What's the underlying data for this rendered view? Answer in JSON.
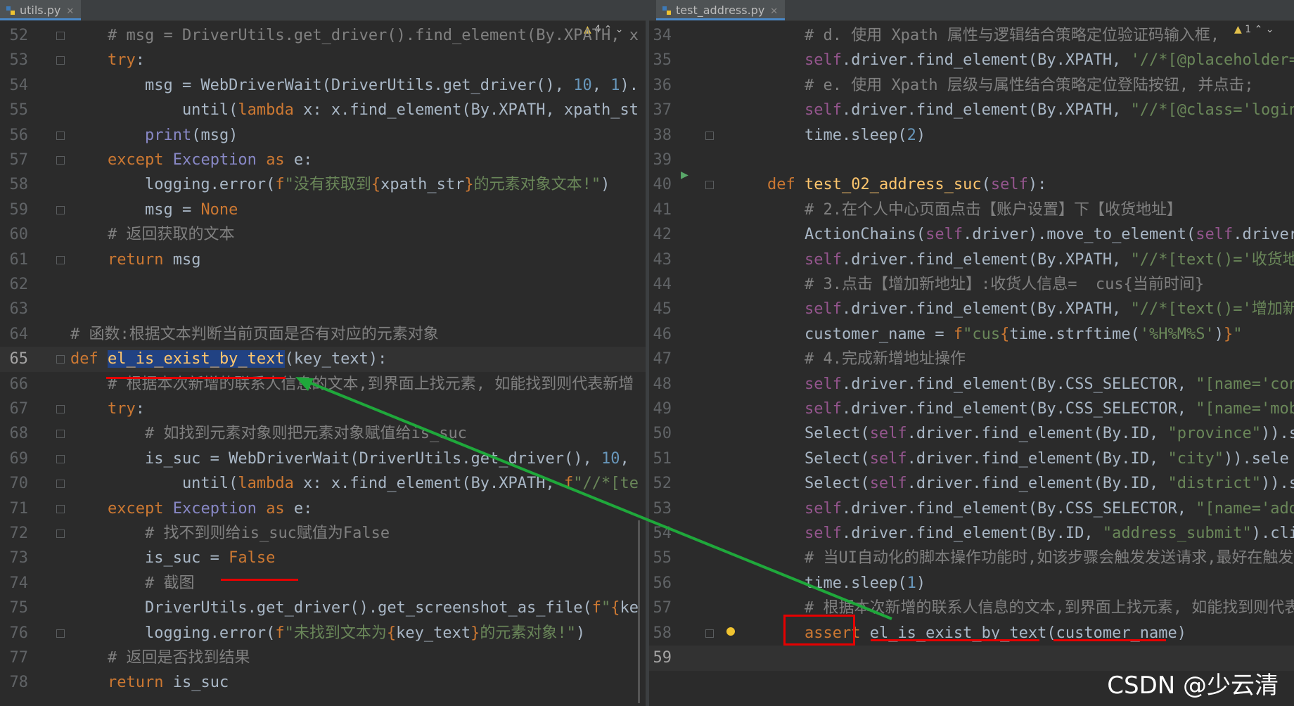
{
  "left_tab": {
    "name": "utils.py"
  },
  "right_tab": {
    "name": "test_address.py"
  },
  "left_warnings": "4",
  "right_warnings": "1",
  "watermark": "CSDN @少云清",
  "colors": {
    "keyword": "#cc7832",
    "comment": "#808080",
    "string": "#6a8759",
    "number": "#6897bb",
    "self": "#94558d",
    "function": "#ffc66d",
    "annotation_red": "#e60000",
    "arrow_green": "#1fa83b"
  },
  "left_lines": [
    {
      "n": "52",
      "html": "    <span class=\"cm\"># msg = DriverUtils.get_driver().find_element(By.XPATH, x</span>"
    },
    {
      "n": "53",
      "html": "    <span class=\"kw\">try</span>:"
    },
    {
      "n": "54",
      "html": "        msg = WebDriverWait(DriverUtils.get_driver(), <span class=\"num\">10</span>, <span class=\"num\">1</span>)."
    },
    {
      "n": "55",
      "html": "            until(<span class=\"kw\">lambda</span> x: x.find_element(By.XPATH, xpath_st"
    },
    {
      "n": "56",
      "html": "        <span class=\"bi\">print</span>(msg)"
    },
    {
      "n": "57",
      "html": "    <span class=\"kw\">except</span> <span class=\"bi\">Exception</span> <span class=\"kw\">as</span> e:"
    },
    {
      "n": "58",
      "html": "        logging.error(<span class=\"kw\">f</span><span class=\"str\">\"没有获取到</span><span class=\"kw\">{</span>xpath_str<span class=\"kw\">}</span><span class=\"str\">的元素对象文本!\"</span>)"
    },
    {
      "n": "59",
      "html": "        msg = <span class=\"kw\">None</span>"
    },
    {
      "n": "60",
      "html": "    <span class=\"cm\"># 返回获取的文本</span>"
    },
    {
      "n": "61",
      "html": "    <span class=\"kw\">return</span> msg"
    },
    {
      "n": "62",
      "html": ""
    },
    {
      "n": "63",
      "html": ""
    },
    {
      "n": "64",
      "html": "<span class=\"cm\"># 函数:根据文本判断当前页面是否有对应的元素对象</span>"
    },
    {
      "n": "65",
      "html": "<span class=\"kw\">def</span> <span class=\"fn sel\">el_is_exist_by_text</span>(key_text):",
      "cur": true
    },
    {
      "n": "66",
      "html": "    <span class=\"cm\"># 根据本次新增的联系人信息的文本,到界面上找元素, 如能找到则代表新增</span>"
    },
    {
      "n": "67",
      "html": "    <span class=\"kw\">try</span>:"
    },
    {
      "n": "68",
      "html": "        <span class=\"cm\"># 如找到元素对象则把元素对象赋值给is_suc</span>"
    },
    {
      "n": "69",
      "html": "        is_suc = WebDriverWait(DriverUtils.get_driver(), <span class=\"num\">10</span>,"
    },
    {
      "n": "70",
      "html": "            until(<span class=\"kw\">lambda</span> x: x.find_element(By.XPATH, <span class=\"kw\">f</span><span class=\"str\">\"//*[te</span>"
    },
    {
      "n": "71",
      "html": "    <span class=\"kw\">except</span> <span class=\"bi\">Exception</span> <span class=\"kw\">as</span> e:"
    },
    {
      "n": "72",
      "html": "        <span class=\"cm\"># 找不到则给is_suc赋值为False</span>"
    },
    {
      "n": "73",
      "html": "        is_suc = <span class=\"kw\">False</span>"
    },
    {
      "n": "74",
      "html": "        <span class=\"cm\"># 截图</span>"
    },
    {
      "n": "75",
      "html": "        DriverUtils.get_driver().get_screenshot_as_file(<span class=\"kw\">f</span><span class=\"str\">\"</span><span class=\"kw\">{</span>ke"
    },
    {
      "n": "76",
      "html": "        logging.error(<span class=\"kw\">f</span><span class=\"str\">\"未找到文本为</span><span class=\"kw\">{</span>key_text<span class=\"kw\">}</span><span class=\"str\">的元素对象!\"</span>)"
    },
    {
      "n": "77",
      "html": "    <span class=\"cm\"># 返回是否找到结果</span>"
    },
    {
      "n": "78",
      "html": "    <span class=\"kw\">return</span> is_suc"
    }
  ],
  "right_lines": [
    {
      "n": "34",
      "html": "        <span class=\"cm\"># d. 使用 Xpath 属性与逻辑结合策略定位验证码输入框,</span>"
    },
    {
      "n": "35",
      "html": "        <span class=\"sf\">self</span>.driver.find_element(By.XPATH, <span class=\"str\">'//*[@placeholder=</span>"
    },
    {
      "n": "36",
      "html": "        <span class=\"cm\"># e. 使用 Xpath 层级与属性结合策略定位登陆按钮, 并点击;</span>"
    },
    {
      "n": "37",
      "html": "        <span class=\"sf\">self</span>.driver.find_element(By.XPATH, <span class=\"str\">\"//*[@class='login</span>"
    },
    {
      "n": "38",
      "html": "        time.sleep(<span class=\"num\">2</span>)"
    },
    {
      "n": "39",
      "html": ""
    },
    {
      "n": "40",
      "html": "    <span class=\"kw\">def</span> <span class=\"fn\">test_02_address_suc</span>(<span class=\"sf\">self</span>):"
    },
    {
      "n": "41",
      "html": "        <span class=\"cm\"># 2.在个人中心页面点击【账户设置】下【收货地址】</span>"
    },
    {
      "n": "42",
      "html": "        ActionChains(<span class=\"sf\">self</span>.driver).move_to_element(<span class=\"sf\">self</span>.driver"
    },
    {
      "n": "43",
      "html": "        <span class=\"sf\">self</span>.driver.find_element(By.XPATH, <span class=\"str\">\"//*[text()='收货地</span>"
    },
    {
      "n": "44",
      "html": "        <span class=\"cm\"># 3.点击【增加新地址】:收货人信息=  cus{当前时间}</span>"
    },
    {
      "n": "45",
      "html": "        <span class=\"sf\">self</span>.driver.find_element(By.XPATH, <span class=\"str\">\"//*[text()='增加新</span>"
    },
    {
      "n": "46",
      "html": "        customer_name = <span class=\"kw\">f</span><span class=\"str\">\"cus</span><span class=\"kw\">{</span>time.strftime(<span class=\"str\">'%H%M%S'</span>)<span class=\"kw\">}</span><span class=\"str\">\"</span>"
    },
    {
      "n": "47",
      "html": "        <span class=\"cm\"># 4.完成新增地址操作</span>"
    },
    {
      "n": "48",
      "html": "        <span class=\"sf\">self</span>.driver.find_element(By.CSS_SELECTOR, <span class=\"str\">\"[name='con</span>"
    },
    {
      "n": "49",
      "html": "        <span class=\"sf\">self</span>.driver.find_element(By.CSS_SELECTOR, <span class=\"str\">\"[name='mob</span>"
    },
    {
      "n": "50",
      "html": "        Select(<span class=\"sf\">self</span>.driver.find_element(By.ID, <span class=\"str\">\"province\"</span>)).s"
    },
    {
      "n": "51",
      "html": "        Select(<span class=\"sf\">self</span>.driver.find_element(By.ID, <span class=\"str\">\"city\"</span>)).sele"
    },
    {
      "n": "52",
      "html": "        Select(<span class=\"sf\">self</span>.driver.find_element(By.ID, <span class=\"str\">\"district\"</span>)).s"
    },
    {
      "n": "53",
      "html": "        <span class=\"sf\">self</span>.driver.find_element(By.CSS_SELECTOR, <span class=\"str\">\"[name='add</span>"
    },
    {
      "n": "54",
      "html": "        <span class=\"sf\">self</span>.driver.find_element(By.ID, <span class=\"str\">\"address_submit\"</span>).cli"
    },
    {
      "n": "55",
      "html": "        <span class=\"cm\"># 当UI自动化的脚本操作功能时,如该步骤会触发发送请求,最好在触发</span>"
    },
    {
      "n": "56",
      "html": "        time.sleep(<span class=\"num\">1</span>)"
    },
    {
      "n": "57",
      "html": "        <span class=\"cm\"># 根据本次新增的联系人信息的文本,到界面上找元素, 如能找到则代表</span>"
    },
    {
      "n": "58",
      "html": "        <span class=\"kw\">assert</span> el_is_exist_by_text(customer_name)"
    },
    {
      "n": "59",
      "html": "",
      "cur": true
    }
  ]
}
